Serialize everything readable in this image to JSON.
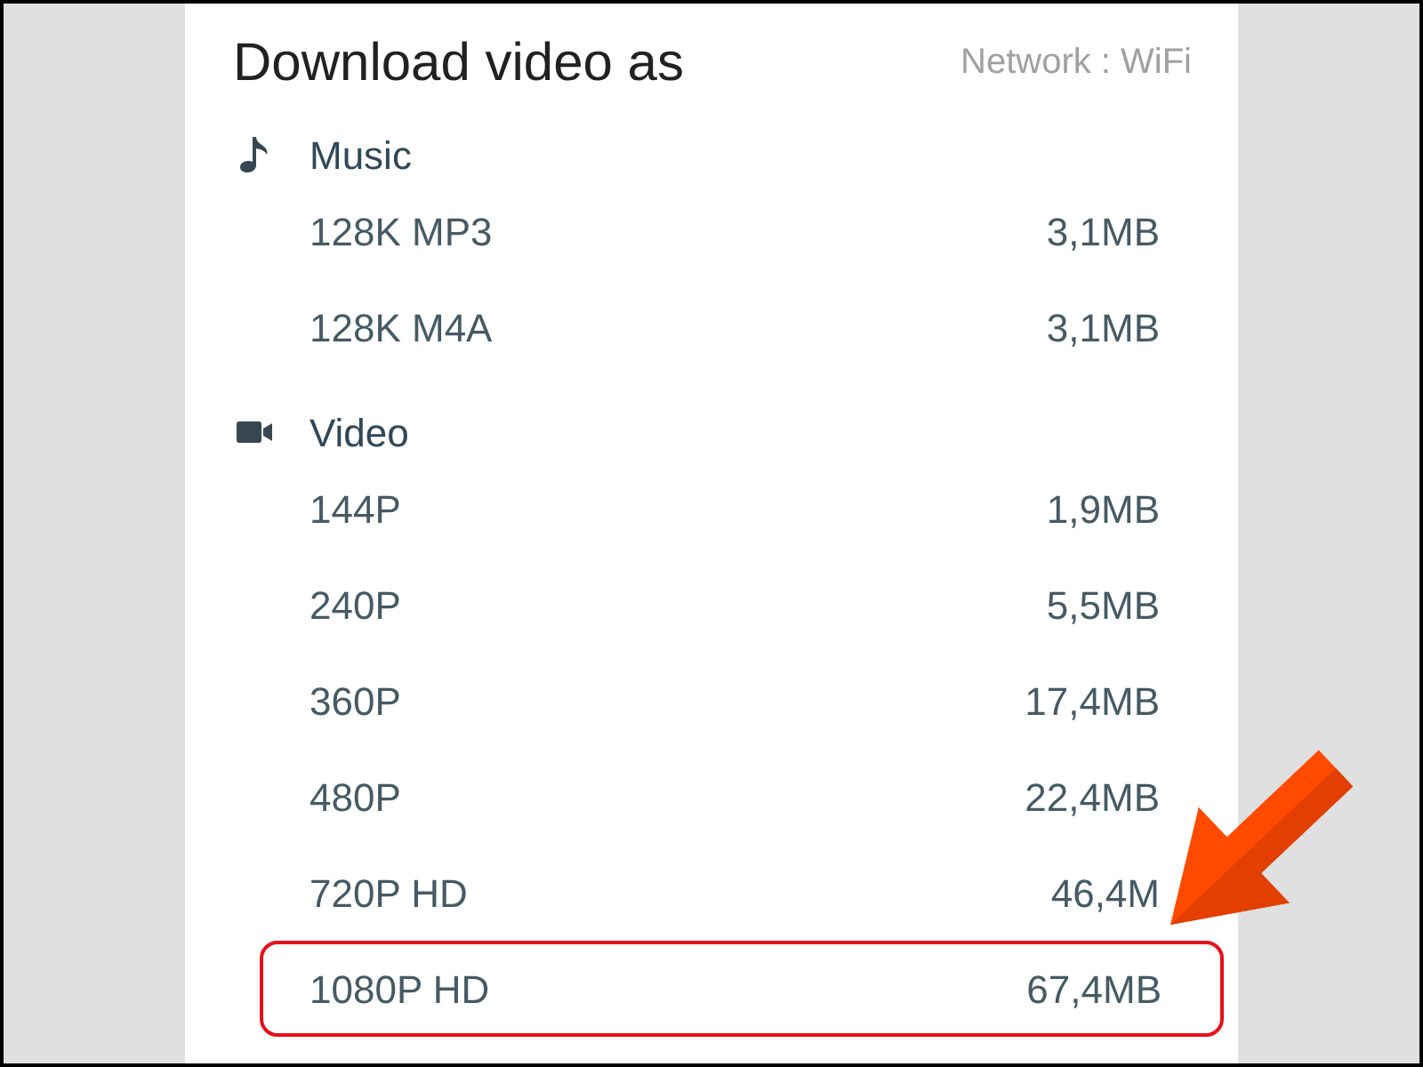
{
  "dialog": {
    "title": "Download video as",
    "network": "Network : WiFi"
  },
  "sections": [
    {
      "kind": "music",
      "label": "Music",
      "options": [
        {
          "label": "128K MP3",
          "size": "3,1MB",
          "highlighted": false
        },
        {
          "label": "128K M4A",
          "size": "3,1MB",
          "highlighted": false
        }
      ]
    },
    {
      "kind": "video",
      "label": "Video",
      "options": [
        {
          "label": "144P",
          "size": "1,9MB",
          "highlighted": false
        },
        {
          "label": "240P",
          "size": "5,5MB",
          "highlighted": false
        },
        {
          "label": "360P",
          "size": "17,4MB",
          "highlighted": false
        },
        {
          "label": "480P",
          "size": "22,4MB",
          "highlighted": false
        },
        {
          "label": "720P HD",
          "size": "46,4M",
          "highlighted": false
        },
        {
          "label": "1080P HD",
          "size": "67,4MB",
          "highlighted": true
        }
      ]
    }
  ]
}
